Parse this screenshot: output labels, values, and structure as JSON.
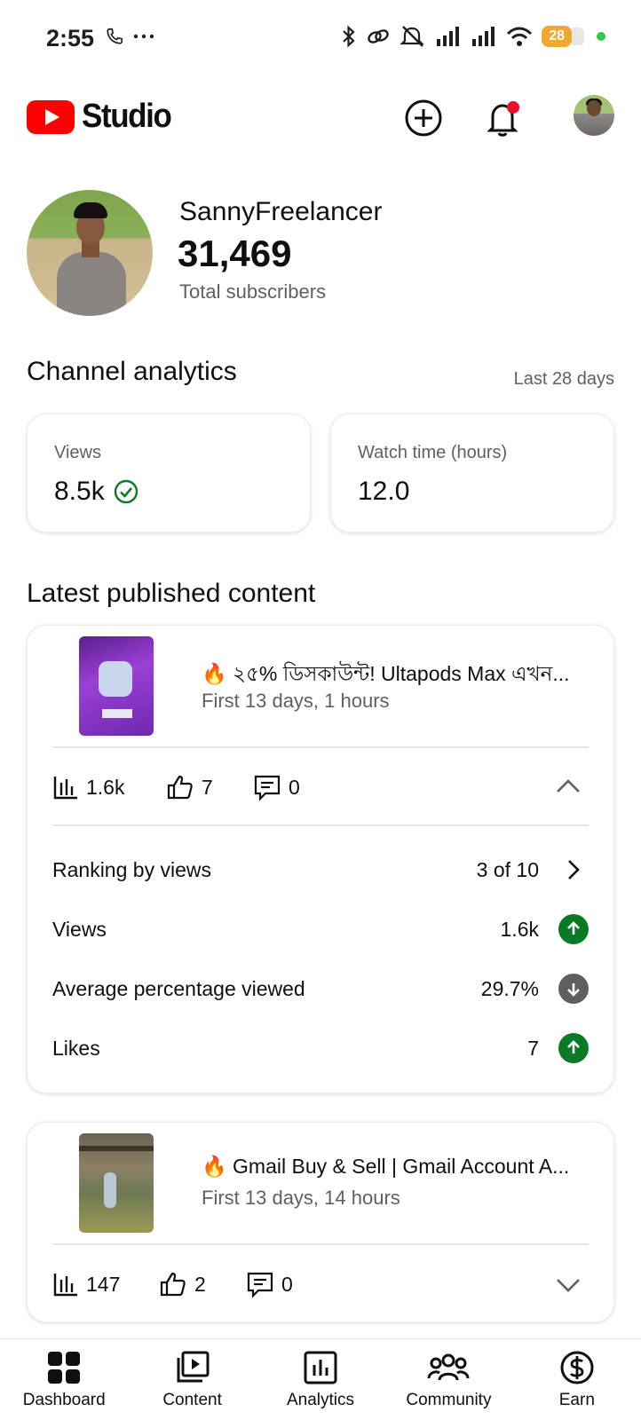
{
  "status_bar": {
    "time": "2:55",
    "battery": "28"
  },
  "app_bar": {
    "logo_text": "Studio"
  },
  "profile": {
    "channel_name": "SannyFreelancer",
    "subscriber_count": "31,469",
    "subscriber_label": "Total subscribers"
  },
  "analytics": {
    "title": "Channel analytics",
    "period": "Last 28 days",
    "cards": [
      {
        "label": "Views",
        "value": "8.5k"
      },
      {
        "label": "Watch time (hours)",
        "value": "12.0"
      }
    ]
  },
  "latest": {
    "title": "Latest published content",
    "items": [
      {
        "title": "🔥 ২৫% ডিসকাউন্ট! Ultapods Max এখন...",
        "subtitle": "First 13 days, 1 hours",
        "views": "1.6k",
        "likes": "7",
        "comments": "0",
        "details": [
          {
            "label": "Ranking by views",
            "value": "3 of 10"
          },
          {
            "label": "Views",
            "value": "1.6k",
            "trend": "up"
          },
          {
            "label": "Average percentage viewed",
            "value": "29.7%",
            "trend": "down"
          },
          {
            "label": "Likes",
            "value": "7",
            "trend": "up"
          }
        ]
      },
      {
        "title": "🔥 Gmail Buy & Sell | Gmail Account A...",
        "subtitle": "First 13 days, 14 hours",
        "views": "147",
        "likes": "2",
        "comments": "0"
      }
    ]
  },
  "bottom_nav": [
    {
      "label": "Dashboard",
      "icon": "dashboard-icon"
    },
    {
      "label": "Content",
      "icon": "content-icon"
    },
    {
      "label": "Analytics",
      "icon": "analytics-icon"
    },
    {
      "label": "Community",
      "icon": "community-icon"
    },
    {
      "label": "Earn",
      "icon": "earn-icon"
    }
  ],
  "colors": {
    "brand_red": "#ff0000",
    "trend_up": "#0b7a24",
    "trend_down": "#5f5f5f",
    "notification_dot": "#e8112d"
  }
}
